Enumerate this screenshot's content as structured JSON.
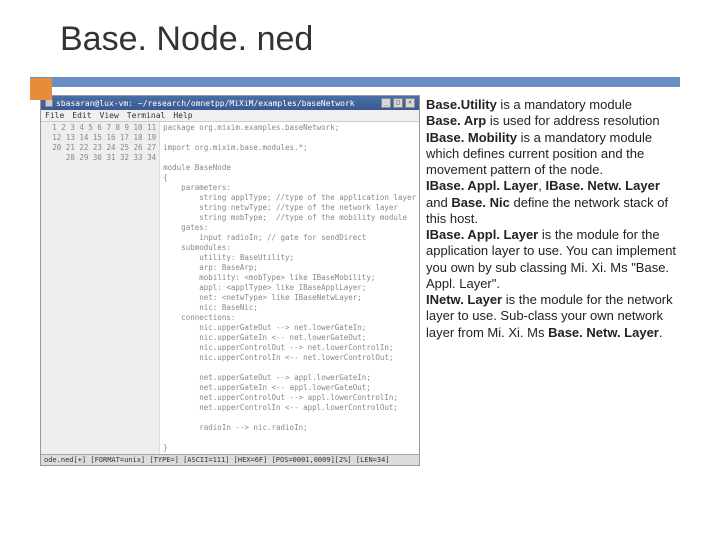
{
  "title": "Base. Node. ned",
  "terminal": {
    "titlebar": "sbasaran@lux-vm: ~/research/omnetpp/MiXiM/examples/baseNetwork",
    "menu": [
      "File",
      "Edit",
      "View",
      "Terminal",
      "Help"
    ],
    "gutter": [
      "1",
      "2",
      "3",
      "4",
      "5",
      "6",
      "7",
      "8",
      "9",
      "10",
      "11",
      "12",
      "13",
      "14",
      "15",
      "16",
      "17",
      "18",
      "19",
      "20",
      "21",
      "22",
      "23",
      "24",
      "25",
      "26",
      "27",
      "28",
      "29",
      "30",
      "31",
      "32",
      "33",
      "34"
    ],
    "code_lines": [
      "package org.mixim.examples.baseNetwork;",
      "",
      "import org.mixim.base.modules.*;",
      "",
      "module BaseNode",
      "{",
      "    parameters:",
      "        string applType; //type of the application layer",
      "        string netwType; //type of the network layer",
      "        string mobType;  //type of the mobility module",
      "    gates:",
      "        input radioIn; // gate for sendDirect",
      "    submodules:",
      "        utility: BaseUtility;",
      "        arp: BaseArp;",
      "        mobility: <mobType> like IBaseMobility;",
      "        appl: <applType> like IBaseApplLayer;",
      "        net: <netwType> like IBaseNetwLayer;",
      "        nic: BaseNic;",
      "    connections:",
      "        nic.upperGateOut --> net.lowerGateIn;",
      "        nic.upperGateIn <-- net.lowerGateOut;",
      "        nic.upperControlOut --> net.lowerControlIn;",
      "        nic.upperControlIn <-- net.lowerControlOut;",
      "",
      "        net.upperGateOut --> appl.lowerGateIn;",
      "        net.upperGateIn <-- appl.lowerGateOut;",
      "        net.upperControlOut --> appl.lowerControlIn;",
      "        net.upperControlIn <-- appl.lowerControlOut;",
      "",
      "        radioIn --> nic.radioIn;",
      "",
      "}",
      ""
    ],
    "status": "ode.ned[+] [FORMAT=unix] [TYPE=] [ASCII=111] [HEX=6F] [POS=0001,0009][2%] [LEN=34]"
  },
  "desc": {
    "t1a": "Base.Utility",
    "t1b": " is a mandatory module",
    "t2a": "Base. Arp",
    "t2b": " is used for address resolution",
    "t3a": "IBase. Mobility",
    "t3b": " is a mandatory module which defines current position and the movement pattern of the node.",
    "t4a": "IBase. Appl. Layer",
    "t4b": ", ",
    "t4c": "IBase. Netw. Layer",
    "t4d": " and ",
    "t4e": "Base. Nic",
    "t4f": " define the network stack of this host.",
    "t5a": "IBase. Appl. Layer",
    "t5b": " is the module for the application layer to use. You can implement you own by sub classing Mi. Xi. Ms \"Base. Appl. Layer\".",
    "t6a": "INetw. Layer",
    "t6b": " is the module for the network layer to use. Sub-class your own network layer from Mi. Xi. Ms ",
    "t6c": "Base. Netw. Layer",
    "t6d": "."
  }
}
